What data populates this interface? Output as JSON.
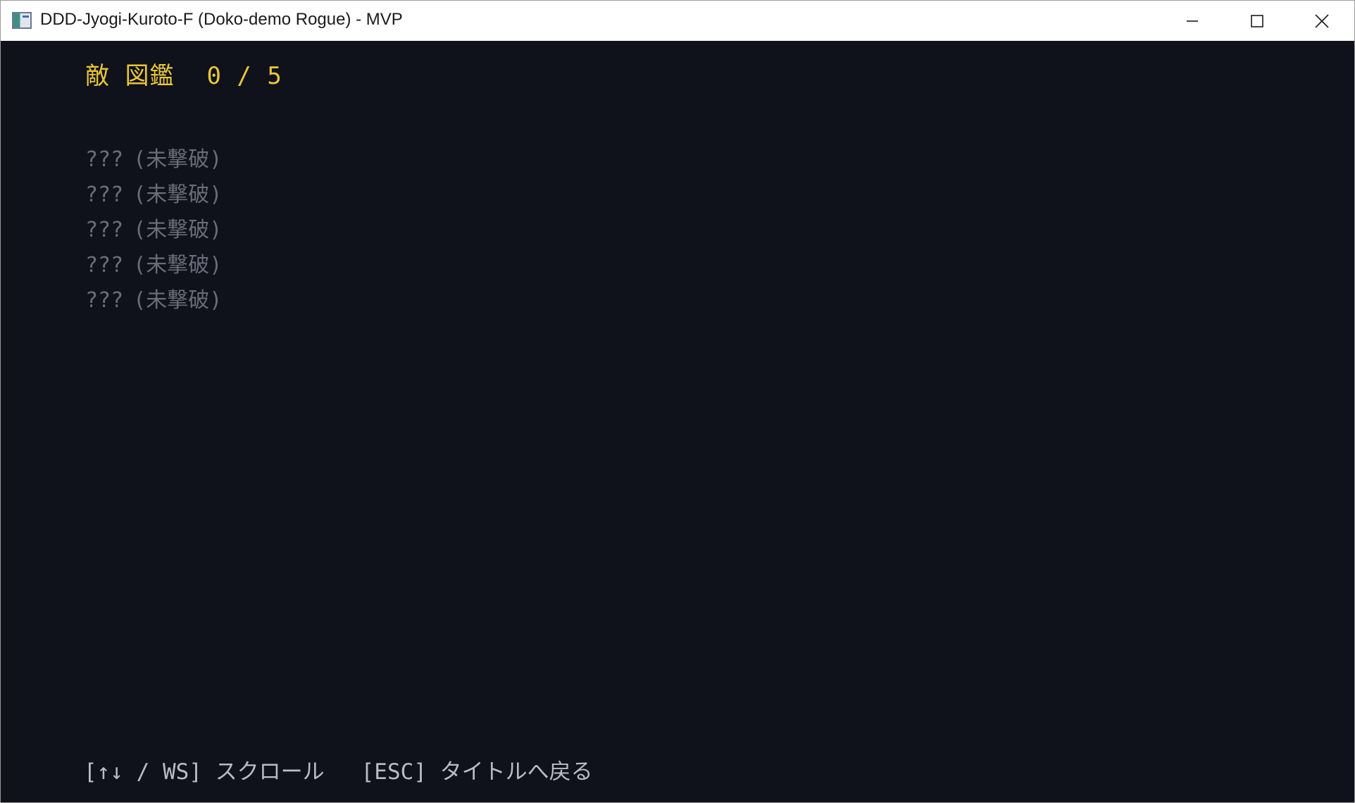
{
  "window": {
    "title": "DDD-Jyogi-Kuroto-F (Doko-demo Rogue) - MVP",
    "icon": "app-icon"
  },
  "bestiary": {
    "title": "敵 図鑑",
    "count": "0 / 5",
    "entries": [
      {
        "name": "???",
        "status": "(未撃破)"
      },
      {
        "name": "???",
        "status": "(未撃破)"
      },
      {
        "name": "???",
        "status": "(未撃破)"
      },
      {
        "name": "???",
        "status": "(未撃破)"
      },
      {
        "name": "???",
        "status": "(未撃破)"
      }
    ]
  },
  "footer": {
    "scroll_hint": "[↑↓ / WS] スクロール",
    "back_hint": "[ESC] タイトルへ戻る"
  },
  "colors": {
    "background": "#0f111b",
    "heading": "#e9c63a",
    "locked_entry": "#6a6d78",
    "footer_text": "#b9bcc6"
  }
}
